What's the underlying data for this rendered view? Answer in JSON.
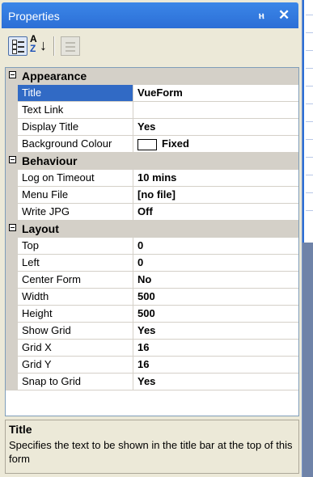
{
  "panel": {
    "title": "Properties",
    "pin_glyph": "ⲏ",
    "close_glyph": "✕"
  },
  "toolbar": {
    "categorized_icon": "categorized-icon",
    "alphabetical_icon": "alphabetical-az-icon",
    "alpha_a": "A",
    "alpha_z": "Z",
    "alpha_arrow": "↓",
    "property_pages_icon": "property-pages-icon"
  },
  "categories": [
    {
      "label": "Appearance",
      "rows": [
        {
          "name": "Title",
          "value": "VueForm",
          "selected": true
        },
        {
          "name": "Text Link",
          "value": ""
        },
        {
          "name": "Display Title",
          "value": "Yes"
        },
        {
          "name": "Background Colour",
          "value": "Fixed",
          "swatch": "#ffffff"
        }
      ]
    },
    {
      "label": "Behaviour",
      "rows": [
        {
          "name": "Log on Timeout",
          "value": "10 mins"
        },
        {
          "name": "Menu File",
          "value": "[no file]"
        },
        {
          "name": "Write JPG",
          "value": "Off"
        }
      ]
    },
    {
      "label": "Layout",
      "rows": [
        {
          "name": "Top",
          "value": "0"
        },
        {
          "name": "Left",
          "value": "0"
        },
        {
          "name": "Center Form",
          "value": "No"
        },
        {
          "name": "Width",
          "value": "500"
        },
        {
          "name": "Height",
          "value": "500"
        },
        {
          "name": "Show Grid",
          "value": "Yes"
        },
        {
          "name": "Grid X",
          "value": "16"
        },
        {
          "name": "Grid Y",
          "value": "16"
        },
        {
          "name": "Snap to Grid",
          "value": "Yes"
        }
      ]
    }
  ],
  "description": {
    "title": "Title",
    "text": "Specifies the text to be shown in the title bar at the top of this form"
  },
  "colors": {
    "titlebar": "#2c6fd6",
    "selection": "#316ac5",
    "category_bg": "#d4d0c8"
  }
}
